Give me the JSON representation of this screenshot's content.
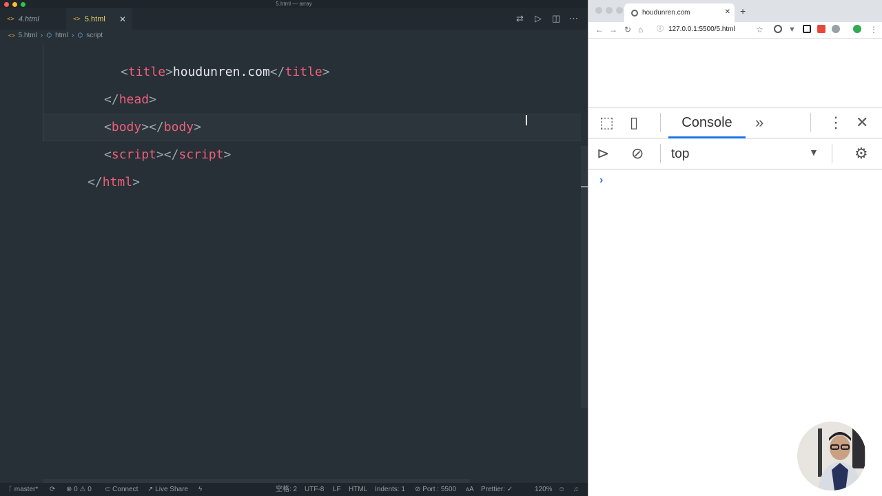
{
  "editor": {
    "window_title": "5.html — array",
    "tabs": [
      {
        "label": "4.html",
        "icon": "code-icon"
      },
      {
        "label": "5.html",
        "icon": "code-icon",
        "active": true
      }
    ],
    "breadcrumb": [
      "5.html",
      "html",
      "script"
    ],
    "code_lines": [
      {
        "indent": "    ",
        "parts": [
          "<",
          "title",
          ">",
          "houdunren.com",
          "</",
          "title",
          ">"
        ]
      },
      {
        "indent": "  ",
        "parts": [
          "</",
          "head",
          ">"
        ]
      },
      {
        "indent": "  ",
        "parts": [
          "<",
          "body",
          ">",
          "</",
          "body",
          ">"
        ]
      },
      {
        "indent": "  ",
        "parts": [
          "<",
          "script",
          ">",
          "</",
          "script",
          ">"
        ]
      },
      {
        "indent": "",
        "parts": [
          "</",
          "html",
          ">"
        ]
      }
    ],
    "status": {
      "branch": "master*",
      "problems": "0",
      "warnings": "0",
      "connect": "Connect",
      "live_share": "Live Share",
      "spaces": "空格: 2",
      "encoding": "UTF-8",
      "eol": "LF",
      "language": "HTML",
      "indents": "Indents: 1",
      "port": "Port : 5500",
      "formatter": "Prettier: ✓",
      "zoom": "120%"
    }
  },
  "browser": {
    "tab_title": "houdunren.com",
    "url": "127.0.0.1:5500/5.html",
    "devtools": {
      "active_tab": "Console",
      "context": "top",
      "prompt": "›"
    }
  },
  "colors": {
    "editor_bg": "#263036",
    "tag": "#ef5f7a",
    "accent_blue": "#1a73e8"
  }
}
